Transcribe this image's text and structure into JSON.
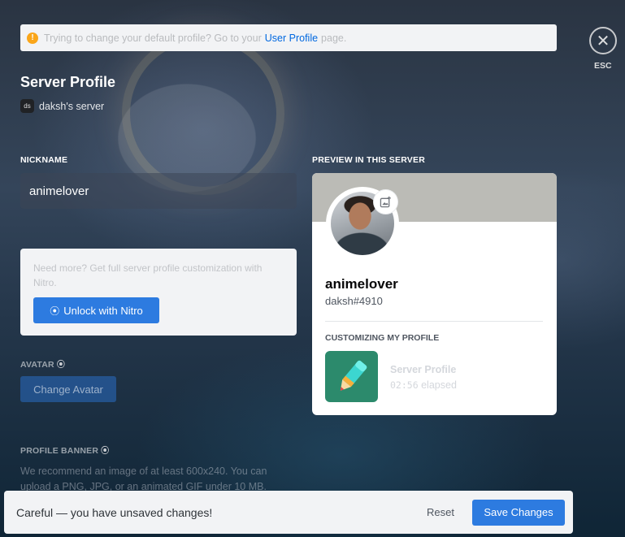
{
  "notice": {
    "text_before": "Trying to change your default profile? Go to your",
    "link": "User Profile",
    "text_after": "page."
  },
  "close": {
    "label": "ESC",
    "icon": "close-icon"
  },
  "page": {
    "title": "Server Profile",
    "server_icon_text": "ds",
    "server_name": "daksh's server"
  },
  "nickname": {
    "label": "NICKNAME",
    "value": "animelover"
  },
  "nitro": {
    "text": "Need more? Get full server profile customization with Nitro.",
    "button": "Unlock with Nitro"
  },
  "avatar_section": {
    "label": "AVATAR",
    "button": "Change Avatar"
  },
  "banner_section": {
    "label": "PROFILE BANNER",
    "description": "We recommend an image of at least 600x240. You can upload a PNG, JPG, or an animated GIF under 10 MB."
  },
  "preview": {
    "label": "PREVIEW IN THIS SERVER",
    "name": "animelover",
    "tag": "daksh#4910",
    "customizing_label": "CUSTOMIZING MY PROFILE",
    "activity_title": "Server Profile",
    "activity_time": "02:56",
    "activity_suffix": "elapsed"
  },
  "unsaved": {
    "text": "Careful — you have unsaved changes!",
    "reset": "Reset",
    "save": "Save Changes"
  },
  "colors": {
    "accent": "#2d7be0",
    "warning": "#faa61a",
    "activity_bg": "#2c8a6c",
    "banner_gray": "#bbbbb6"
  }
}
